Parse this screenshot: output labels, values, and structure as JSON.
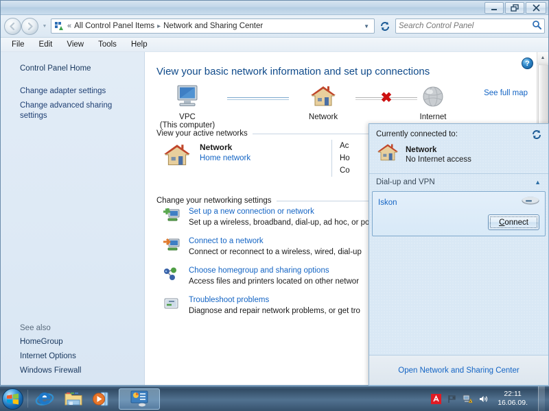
{
  "window": {
    "minimize_label": "Minimize",
    "restore_label": "Restore",
    "close_label": "Close"
  },
  "nav": {
    "back_label": "Back",
    "forward_label": "Forward",
    "recent_label": "Recent pages",
    "breadcrumb_chevron": "«",
    "breadcrumb": [
      "All Control Panel Items",
      "Network and Sharing Center"
    ],
    "breadcrumb_separator": "▸",
    "refresh_label": "Refresh",
    "cp_icon": "control-panel-icon"
  },
  "search": {
    "placeholder": "Search Control Panel",
    "value": "",
    "icon": "search-icon"
  },
  "menu": {
    "items": [
      "File",
      "Edit",
      "View",
      "Tools",
      "Help"
    ]
  },
  "sidebar": {
    "home_label": "Control Panel Home",
    "links": [
      "Change adapter settings",
      "Change advanced sharing settings"
    ],
    "see_also_title": "See also",
    "see_also": [
      "HomeGroup",
      "Internet Options",
      "Windows Firewall"
    ]
  },
  "content": {
    "help_label": "?",
    "title": "View your basic network information and set up connections",
    "see_full_map": "See full map",
    "map": {
      "computer": {
        "label": "VPC",
        "sub": "(This computer)",
        "icon": "computer-icon"
      },
      "network": {
        "label": "Network",
        "icon": "house-icon"
      },
      "internet": {
        "label": "Internet",
        "icon": "globe-icon"
      },
      "link1_state": "connected",
      "link2_state": "broken",
      "broken_marker": "✖"
    },
    "active_networks_heading": "View your active networks",
    "active_network": {
      "icon": "house-icon",
      "name": "Network",
      "type": "Home network"
    },
    "active_details": [
      "Ac",
      "Ho",
      "Co"
    ],
    "settings_heading": "Change your networking settings",
    "settings": [
      {
        "icon": "new-connection-icon",
        "link": "Set up a new connection or network",
        "desc": "Set up a wireless, broadband, dial-up, ad hoc, or \npoint."
      },
      {
        "icon": "connect-network-icon",
        "link": "Connect to a network",
        "desc": "Connect or reconnect to a wireless, wired, dial-up"
      },
      {
        "icon": "homegroup-icon",
        "link": "Choose homegroup and sharing options",
        "desc": "Access files and printers located on other networ"
      },
      {
        "icon": "troubleshoot-icon",
        "link": "Troubleshoot problems",
        "desc": "Diagnose and repair network problems, or get tro"
      }
    ]
  },
  "flyout": {
    "refresh_label": "Refresh",
    "connected_title": "Currently connected to:",
    "connected_network": {
      "icon": "house-icon",
      "name": "Network",
      "status": "No Internet access"
    },
    "group_label": "Dial-up and VPN",
    "group_chevron": "▲",
    "item": {
      "name": "Iskon",
      "icon": "modem-icon",
      "button_prefix": "",
      "button_accel": "C",
      "button_rest": "onnect",
      "button_label": "Connect"
    },
    "footer_link": "Open Network and Sharing Center"
  },
  "taskbar": {
    "start_label": "Start",
    "buttons": [
      {
        "name": "internet-explorer",
        "label": "Internet Explorer"
      },
      {
        "name": "windows-explorer",
        "label": "Windows Explorer"
      },
      {
        "name": "media-player",
        "label": "Windows Media Player"
      },
      {
        "name": "control-panel-window",
        "label": "Network and Sharing Center"
      }
    ],
    "tray": [
      {
        "name": "antivirus-icon",
        "label": "Avira"
      },
      {
        "name": "action-flag-icon",
        "label": "Action Center"
      },
      {
        "name": "network-warning-icon",
        "label": "Network"
      },
      {
        "name": "volume-icon",
        "label": "Volume"
      }
    ],
    "clock_time": "22:11",
    "clock_date": "16.06.09.",
    "show_desktop_label": "Show desktop"
  },
  "colors": {
    "accent_link": "#1364c4",
    "title_blue": "#0f4a8a",
    "error_red": "#cc1111",
    "sidebar_bg": "#dde9f5"
  }
}
